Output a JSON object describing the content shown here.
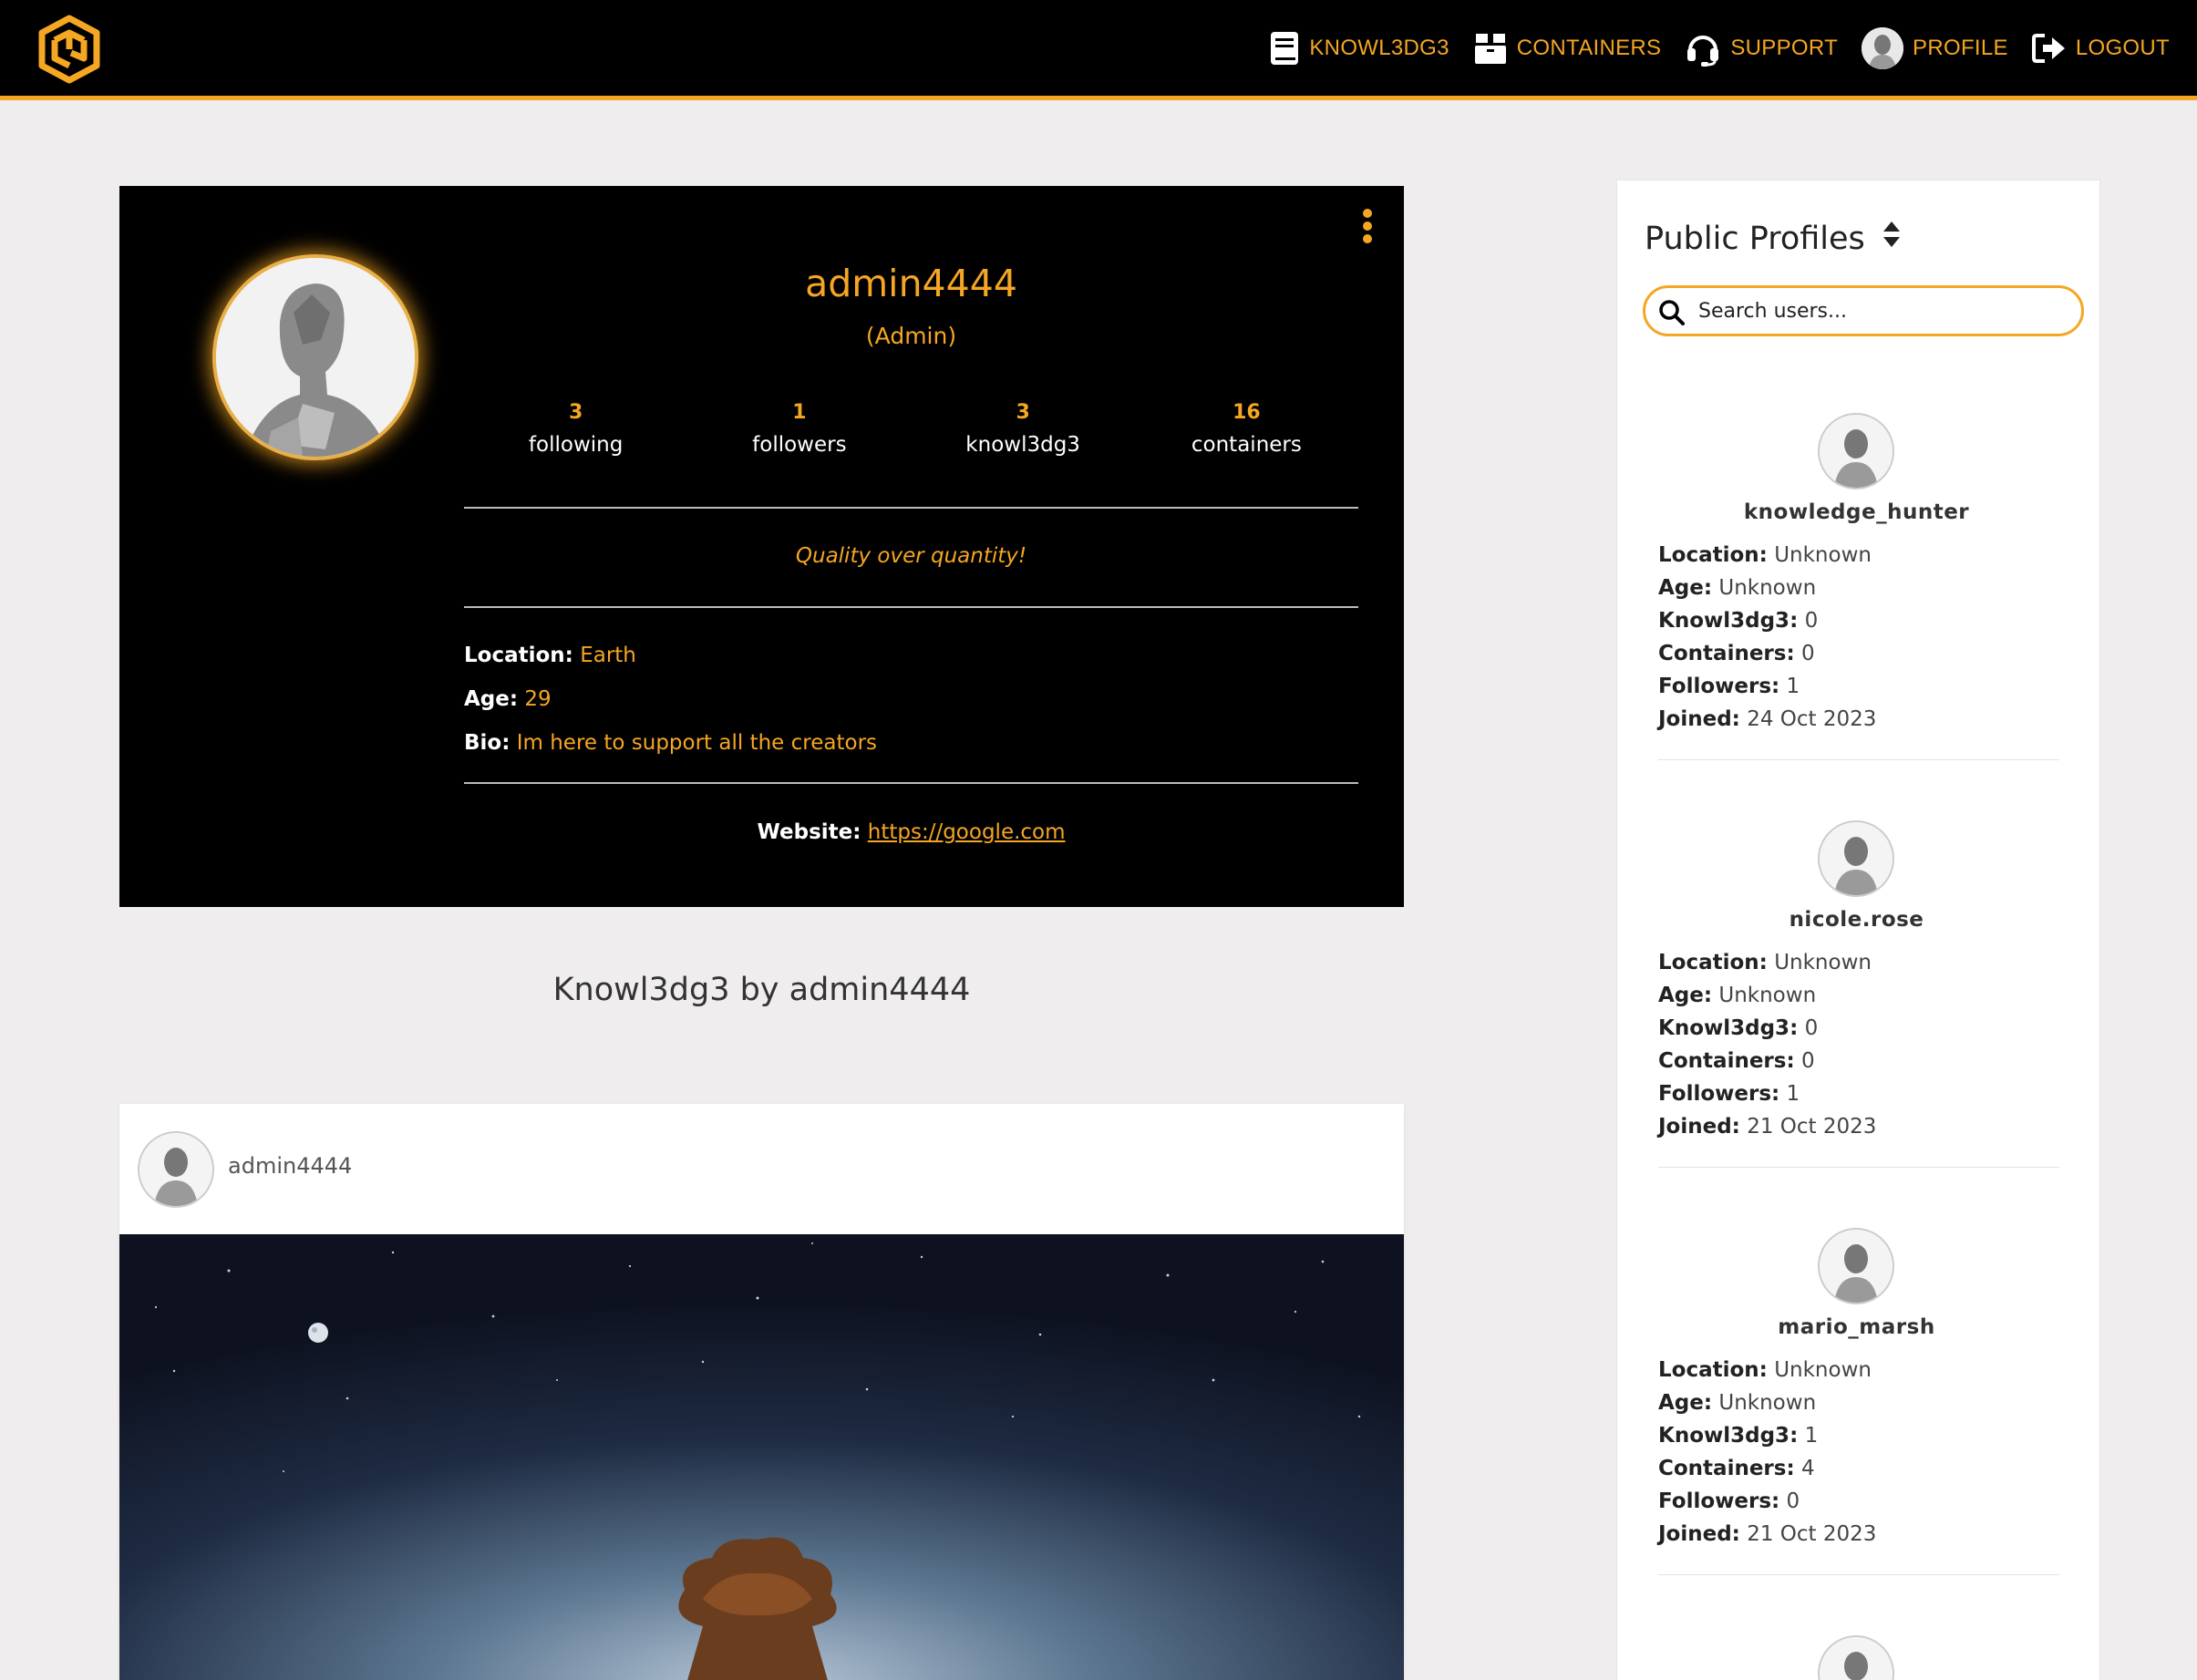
{
  "nav": {
    "items": [
      {
        "label": "KNOWL3DG3",
        "icon": "book-icon"
      },
      {
        "label": "CONTAINERS",
        "icon": "box-icon"
      },
      {
        "label": "SUPPORT",
        "icon": "headset-icon"
      },
      {
        "label": "PROFILE",
        "icon": "avatar"
      },
      {
        "label": "LOGOUT",
        "icon": "logout-icon"
      }
    ]
  },
  "profile": {
    "username": "admin4444",
    "role": "(Admin)",
    "stats": [
      {
        "value": "3",
        "label": "following"
      },
      {
        "value": "1",
        "label": "followers"
      },
      {
        "value": "3",
        "label": "knowl3dg3"
      },
      {
        "value": "16",
        "label": "containers"
      }
    ],
    "quote": "Quality over quantity!",
    "location_label": "Location:",
    "location": "Earth",
    "age_label": "Age:",
    "age": "29",
    "bio_label": "Bio:",
    "bio": "Im here to support all the creators",
    "website_label": "Website:",
    "website": "https://google.com"
  },
  "section_title": "Knowl3dg3 by admin4444",
  "post": {
    "username": "admin4444"
  },
  "sidebar": {
    "title": "Public Profiles",
    "search_placeholder": "Search users...",
    "labels": {
      "location": "Location:",
      "age": "Age:",
      "knowl3dg3": "Knowl3dg3:",
      "containers": "Containers:",
      "followers": "Followers:",
      "joined": "Joined:"
    },
    "users": [
      {
        "name": "knowledge_hunter",
        "location": "Unknown",
        "age": "Unknown",
        "knowl3dg3": "0",
        "containers": "0",
        "followers": "1",
        "joined": "24 Oct 2023"
      },
      {
        "name": "nicole.rose",
        "location": "Unknown",
        "age": "Unknown",
        "knowl3dg3": "0",
        "containers": "0",
        "followers": "1",
        "joined": "21 Oct 2023"
      },
      {
        "name": "mario_marsh",
        "location": "Unknown",
        "age": "Unknown",
        "knowl3dg3": "1",
        "containers": "4",
        "followers": "0",
        "joined": "21 Oct 2023"
      }
    ]
  },
  "colors": {
    "accent": "#f5a623",
    "navbar": "#000000",
    "page_bg": "#efeded"
  }
}
